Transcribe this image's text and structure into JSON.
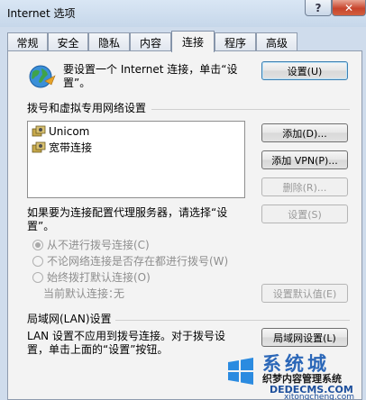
{
  "window": {
    "title": "Internet 选项",
    "help_label": "?",
    "close_label": "✕"
  },
  "tabs": [
    {
      "label": "常规"
    },
    {
      "label": "安全"
    },
    {
      "label": "隐私"
    },
    {
      "label": "内容"
    },
    {
      "label": "连接"
    },
    {
      "label": "程序"
    },
    {
      "label": "高级"
    }
  ],
  "active_tab": "连接",
  "setup": {
    "text_line1": "要设置一个 Internet 连接，单击“设",
    "text_line2": "置”。",
    "button": "设置(U)"
  },
  "dialup": {
    "heading": "拨号和虚拟专用网络设置",
    "connections": [
      "Unicom",
      "宽带连接"
    ],
    "add_button": "添加(D)...",
    "add_vpn_button": "添加 VPN(P)...",
    "delete_button": "删除(R)...",
    "proxy_text_line1": "如果要为连接配置代理服务器，请选择“设",
    "proxy_text_line2": "置”。",
    "settings_button": "设置(S)",
    "options": [
      {
        "label": "从不进行拨号连接(C)",
        "checked": true
      },
      {
        "label": "不论网络连接是否存在都进行拨号(W)",
        "checked": false
      },
      {
        "label": "始终拨打默认连接(O)",
        "checked": false
      }
    ],
    "default_label": "当前默认连接：",
    "default_value": "无",
    "set_default_button": "设置默认值(E)"
  },
  "lan": {
    "heading": "局域网(LAN)设置",
    "text_line1": "LAN 设置不应用到拨号连接。对于拨号设",
    "text_line2": "置，单击上面的“设置”按钮。",
    "button": "局域网设置(L)"
  },
  "watermark": {
    "big": "系统城",
    "small": "织梦内容管理系统",
    "url": "DEDECMS.COM",
    "url2": "xitongcheng.com"
  },
  "colors": {
    "accent_blue": "#2b67b8",
    "close_red": "#c7442c",
    "panel_bg": "#f3f3f3"
  }
}
